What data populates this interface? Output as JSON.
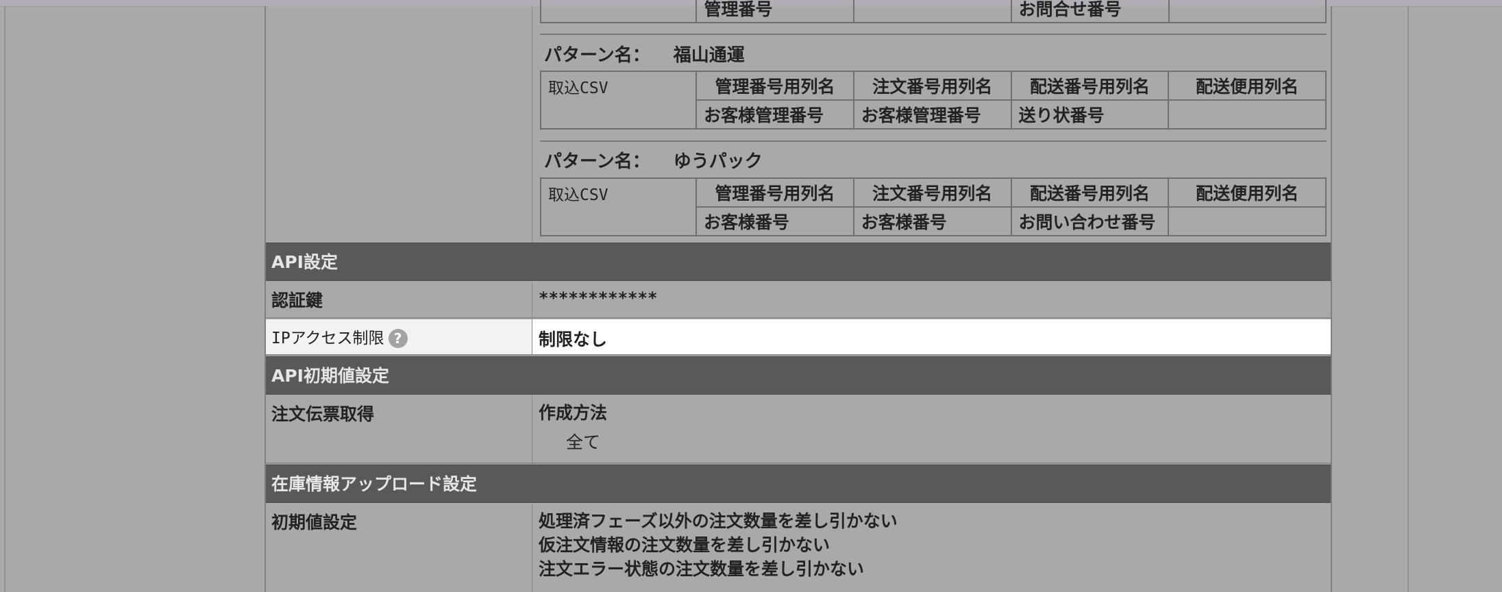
{
  "partial_top_row": {
    "cell_kanri": "管理番号",
    "cell_toiawase": "お問合せ番号"
  },
  "patterns": [
    {
      "label": "パターン名：",
      "name": "福山通運",
      "row_label": "取込CSV",
      "headers": [
        "管理番号用列名",
        "注文番号用列名",
        "配送番号用列名",
        "配送便用列名"
      ],
      "values": [
        "お客様管理番号",
        "お客様管理番号",
        "送り状番号",
        ""
      ]
    },
    {
      "label": "パターン名：",
      "name": "ゆうパック",
      "row_label": "取込CSV",
      "headers": [
        "管理番号用列名",
        "注文番号用列名",
        "配送番号用列名",
        "配送便用列名"
      ],
      "values": [
        "お客様番号",
        "お客様番号",
        "お問い合わせ番号",
        ""
      ]
    }
  ],
  "sections": {
    "api": {
      "title": "API設定",
      "auth_key_label": "認証鍵",
      "auth_key_value": "************",
      "ip_label": "IPアクセス制限",
      "ip_value": "制限なし",
      "help_glyph": "?"
    },
    "api_initial": {
      "title": "API初期値設定",
      "order_label": "注文伝票取得",
      "method_label": "作成方法",
      "method_value": "全て"
    },
    "stock": {
      "title": "在庫情報アップロード設定",
      "initial_label": "初期値設定",
      "lines": [
        "処理済フェーズ以外の注文数量を差し引かない",
        "仮注文情報の注文数量を差し引かない",
        "注文エラー状態の注文数量を差し引かない"
      ]
    }
  },
  "colors": {
    "section_bg": "#595959",
    "body_bg": "#a9a9a9",
    "highlight_row": "#ffffff"
  }
}
